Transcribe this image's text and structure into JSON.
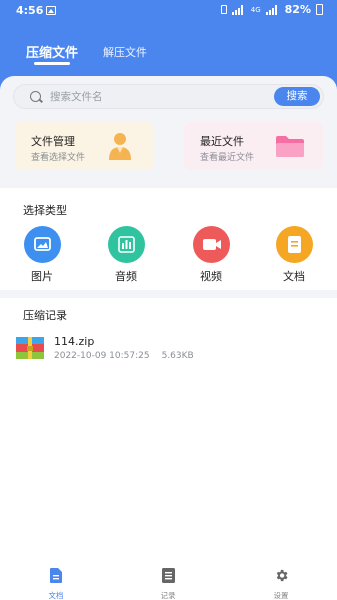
{
  "status_bar": {
    "time": "4:56",
    "network_label": "4G",
    "battery": "82%"
  },
  "tabs": [
    {
      "label": "压缩文件",
      "active": true
    },
    {
      "label": "解压文件",
      "active": false
    }
  ],
  "search": {
    "placeholder": "搜索文件名",
    "value": "",
    "button_label": "搜索"
  },
  "cards": [
    {
      "title": "文件管理",
      "subtitle": "查看选择文件",
      "icon": "person-icon"
    },
    {
      "title": "最近文件",
      "subtitle": "查看最近文件",
      "icon": "folder-icon"
    }
  ],
  "types_section": {
    "title": "选择类型",
    "items": [
      {
        "label": "图片",
        "icon": "image-icon",
        "color": "#3d8ff0"
      },
      {
        "label": "音频",
        "icon": "audio-bars-icon",
        "color": "#2fc39f"
      },
      {
        "label": "视频",
        "icon": "video-camera-icon",
        "color": "#ee5a5a"
      },
      {
        "label": "文档",
        "icon": "document-icon",
        "color": "#f5a623"
      }
    ]
  },
  "records_section": {
    "title": "压缩记录",
    "items": [
      {
        "name": "114.zip",
        "date": "2022-10-09 10:57:25",
        "size": "5.63KB",
        "icon": "zip-archive-icon"
      }
    ]
  },
  "bottom_nav": [
    {
      "label": "文档",
      "icon": "document-icon",
      "active": true
    },
    {
      "label": "记录",
      "icon": "list-icon",
      "active": false
    },
    {
      "label": "设置",
      "icon": "gear-icon",
      "active": false
    }
  ],
  "colors": {
    "primary": "#4a86ee",
    "background": "#f3f4f7"
  }
}
